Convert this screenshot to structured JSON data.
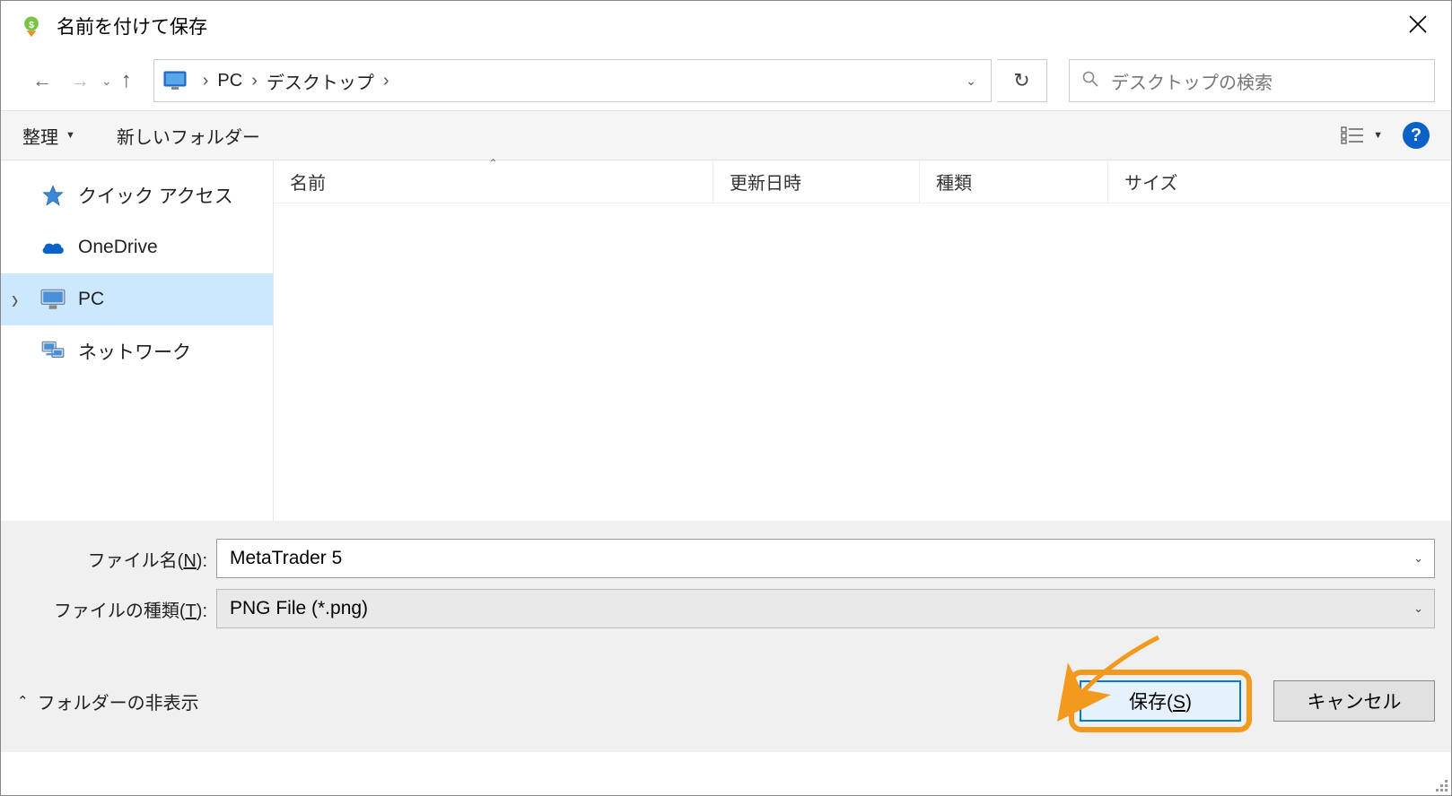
{
  "titlebar": {
    "title": "名前を付けて保存"
  },
  "nav": {
    "breadcrumb": {
      "pc": "PC",
      "desktop": "デスクトップ"
    }
  },
  "search": {
    "placeholder": "デスクトップの検索"
  },
  "toolbar": {
    "organize": "整理",
    "newfolder": "新しいフォルダー"
  },
  "sidebar": {
    "quickaccess": "クイック アクセス",
    "onedrive": "OneDrive",
    "pc": "PC",
    "network": "ネットワーク"
  },
  "columns": {
    "name": "名前",
    "date": "更新日時",
    "type": "種類",
    "size": "サイズ"
  },
  "fields": {
    "filename_label_pre": "ファイル名(",
    "filename_label_u": "N",
    "filename_label_post": "):",
    "filename_value": "MetaTrader 5",
    "filetype_label_pre": "ファイルの種類(",
    "filetype_label_u": "T",
    "filetype_label_post": "):",
    "filetype_value": "PNG File (*.png)"
  },
  "footer": {
    "hidefolders": "フォルダーの非表示",
    "save_pre": "保存(",
    "save_u": "S",
    "save_post": ")",
    "cancel": "キャンセル"
  }
}
